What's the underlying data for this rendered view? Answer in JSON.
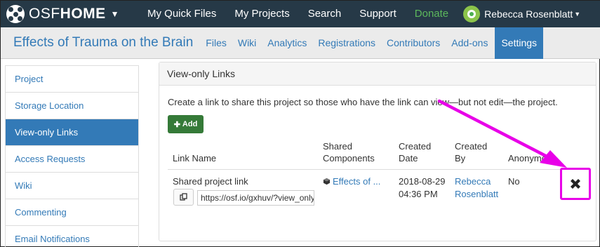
{
  "navbar": {
    "brand_osf": "OSF",
    "brand_home": "HOME",
    "links": [
      "My Quick Files",
      "My Projects",
      "Search",
      "Support"
    ],
    "donate": "Donate",
    "user_name": "Rebecca Rosenblatt"
  },
  "project": {
    "title": "Effects of Trauma on the Brain",
    "tabs": [
      "Files",
      "Wiki",
      "Analytics",
      "Registrations",
      "Contributors",
      "Add-ons"
    ],
    "active_tab": "Settings"
  },
  "sidebar": {
    "items": [
      "Project",
      "Storage Location",
      "View-only Links",
      "Access Requests",
      "Wiki",
      "Commenting",
      "Email Notifications"
    ],
    "active_index": 2
  },
  "panel": {
    "title": "View-only Links",
    "description": "Create a link to share this project so those who have the link can view—but not edit—the project.",
    "add_label": "Add",
    "columns": {
      "link_name": "Link Name",
      "shared_1": "Shared",
      "shared_2": "Components",
      "created_1": "Created",
      "created_2": "Date",
      "by_1": "Created",
      "by_2": "By",
      "anon": "Anonymous"
    },
    "row": {
      "name": "Shared project link",
      "url": "https://osf.io/gxhuv/?view_only=",
      "component": "Effects of ...",
      "date": "2018-08-29",
      "time": "04:36 PM",
      "by_first": "Rebecca",
      "by_last": "Rosenblatt",
      "anonymous": "No"
    }
  },
  "colors": {
    "navbar_bg": "#263947",
    "accent": "#337ab7",
    "donate": "#5cb85c",
    "add_button": "#357a38",
    "annotation": "#e800e8"
  },
  "icons": [
    "chevron-down-icon",
    "copy-icon",
    "plus-icon",
    "delete-x-icon",
    "cube-icon"
  ]
}
